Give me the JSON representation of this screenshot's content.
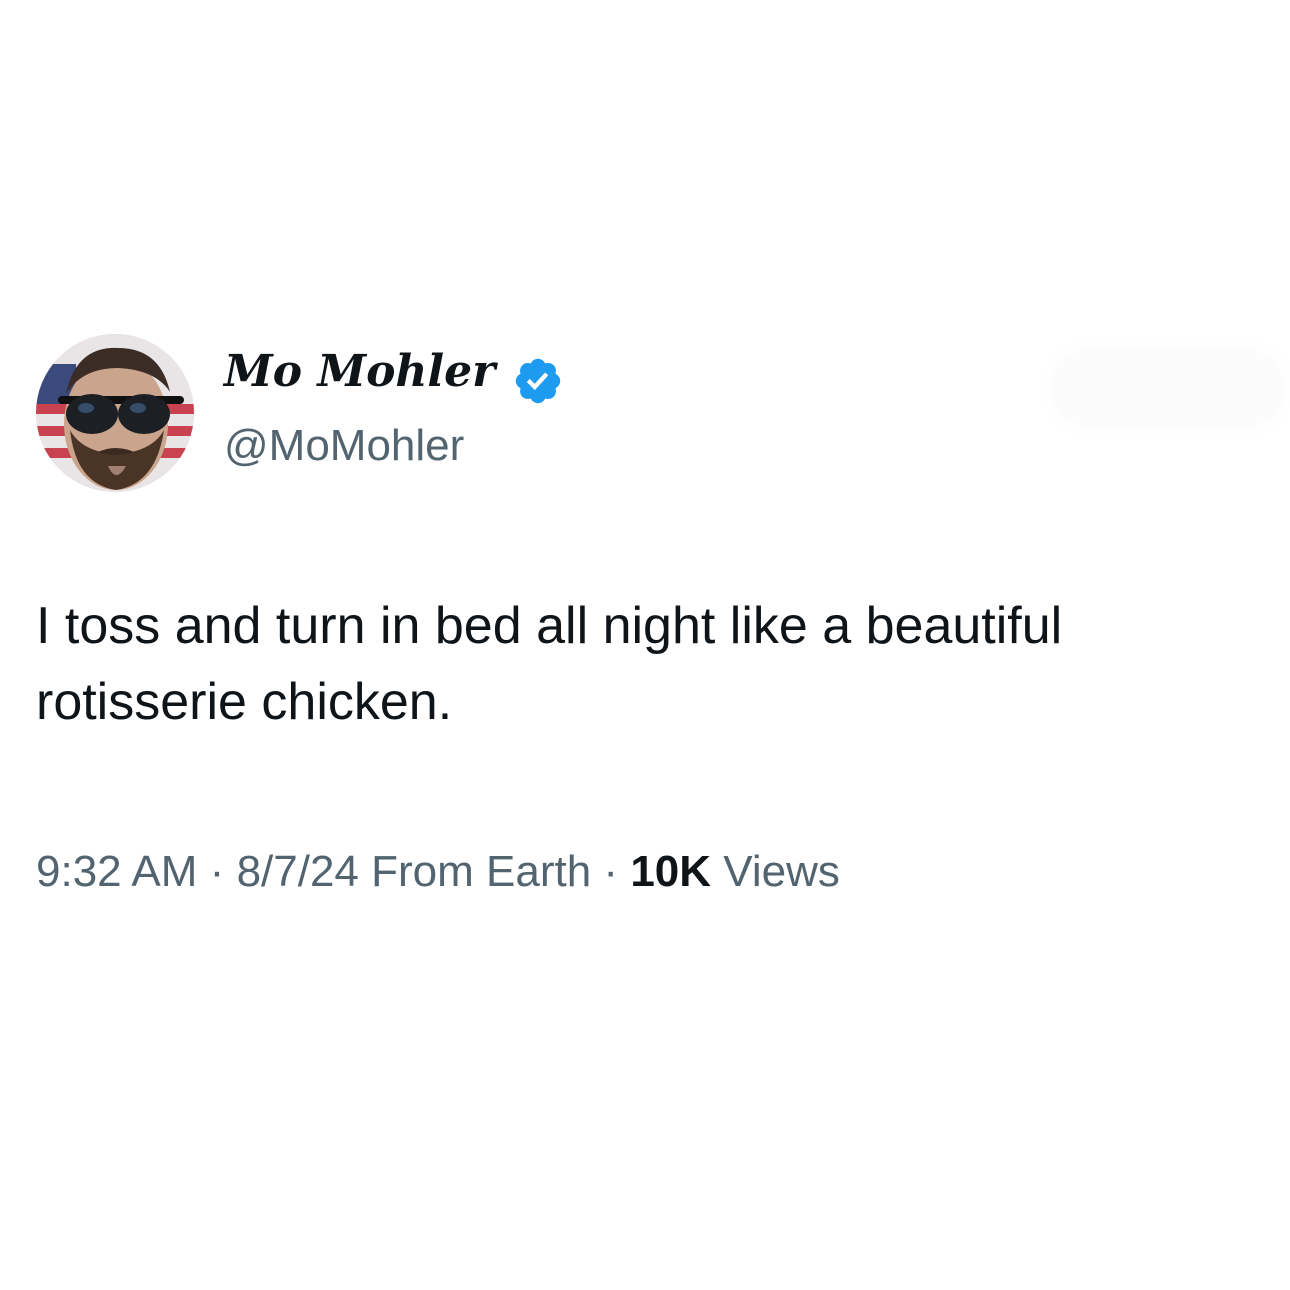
{
  "tweet": {
    "author": {
      "display_name": "Mo Mohler",
      "handle": "@MoMohler",
      "verified": true,
      "avatar_icon": "profile-photo"
    },
    "text": "I toss and turn in bed all night like a beautiful rotisserie chicken.",
    "meta": {
      "time": "9:32 AM",
      "separator": "·",
      "date": "8/7/24",
      "source": "From Earth",
      "views_count": "10K",
      "views_label": "Views"
    }
  },
  "colors": {
    "text_primary": "#0f1419",
    "text_secondary": "#536471",
    "verified_blue": "#1d9bf0",
    "background": "#ffffff"
  }
}
